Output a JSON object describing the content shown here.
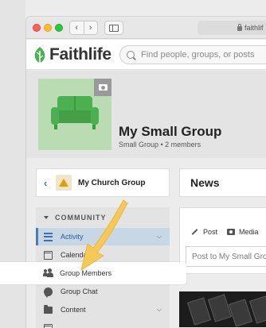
{
  "header": {
    "brand": "Faithlife",
    "url_text": "faithlif",
    "search_placeholder": "Find people, groups, or posts"
  },
  "group": {
    "title": "My Small Group",
    "subtitle": "Small Group • 2 members"
  },
  "parent_group": {
    "name": "My Church Group"
  },
  "sidebar": {
    "section_label": "COMMUNITY",
    "items": [
      {
        "label": "Activity",
        "icon": "activity-icon",
        "active": true
      },
      {
        "label": "Calendar",
        "icon": "calendar-icon"
      },
      {
        "label": "Group Members",
        "icon": "group-members-icon",
        "highlighted": true
      },
      {
        "label": "Group Chat",
        "icon": "chat-icon"
      },
      {
        "label": "Content",
        "icon": "folder-icon"
      }
    ]
  },
  "news": {
    "title": "News",
    "post_tab": "Post",
    "media_tab": "Media",
    "post_placeholder": "Post to My Small Group"
  },
  "colors": {
    "brand_green": "#4caf50",
    "active_nav_bg": "#c7d7e6",
    "active_nav_border": "#4a7cb5",
    "pointer_arrow": "#f5c85a"
  }
}
